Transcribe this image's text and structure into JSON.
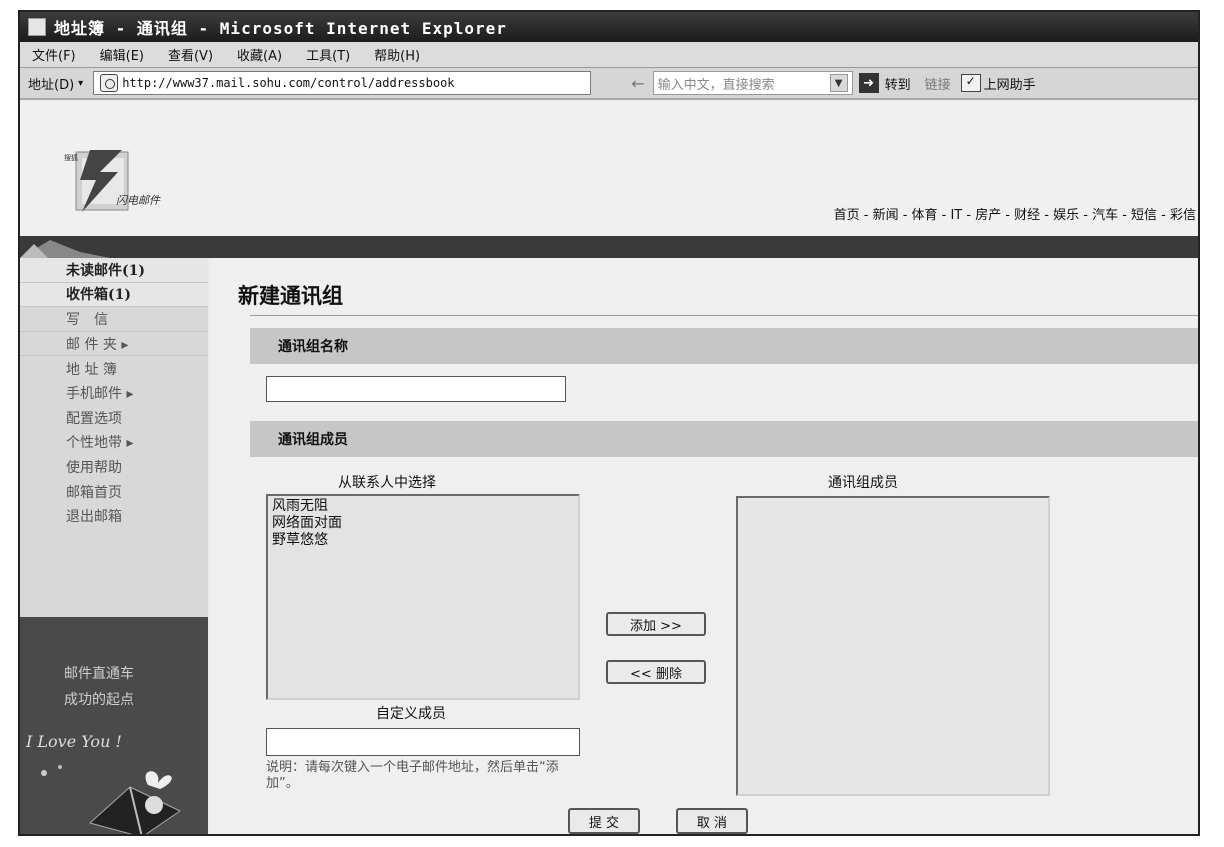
{
  "window": {
    "title": "地址簿 - 通讯组 - Microsoft Internet Explorer"
  },
  "menubar": {
    "items": [
      "文件(F)",
      "编辑(E)",
      "查看(V)",
      "收藏(A)",
      "工具(T)",
      "帮助(H)"
    ]
  },
  "addressbar": {
    "label": "地址(D)",
    "url": "http://www37.mail.sohu.com/control/addressbook",
    "search_placeholder": "输入中文，直接搜索",
    "go_label": "转到",
    "links_label": "链接",
    "helper_label": "上网助手"
  },
  "banner": {
    "nav": "首页 - 新闻 - 体育 - IT - 房产 - 财经 - 娱乐 - 汽车 - 短信 - 彩信"
  },
  "sidebar": {
    "items": [
      "未读邮件(1)",
      "收件箱(1)",
      "写　信",
      "邮 件 夹 ▸",
      "地 址 簿",
      "手机邮件 ▸",
      "配置选项",
      "个性地带 ▸",
      "使用帮助",
      "邮箱首页",
      "退出邮箱"
    ],
    "promo": [
      "邮件直通车",
      "成功的起点"
    ]
  },
  "form": {
    "title": "新建通讯组",
    "name_section": "通讯组名称",
    "members_section": "通讯组成员",
    "contacts_label": "从联系人中选择",
    "contacts": [
      "风雨无阻",
      "网络面对面",
      "野草悠悠"
    ],
    "members_label": "通讯组成员",
    "add_button": "添加 >>",
    "remove_button": "<< 删除",
    "custom_label": "自定义成员",
    "note": "说明：请每次键入一个电子邮件地址，然后单击“添加”。",
    "submit_button": "提 交",
    "cancel_button": "取 消"
  }
}
